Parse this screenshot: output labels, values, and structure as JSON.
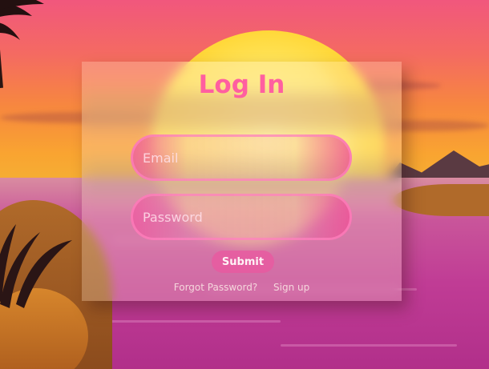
{
  "login": {
    "title": "Log In",
    "email_placeholder": "Email",
    "password_placeholder": "Password",
    "submit_label": "Submit",
    "forgot_password_label": "Forgot Password?",
    "signup_label": "Sign up"
  },
  "colors": {
    "title": "#ff5fa0",
    "accent": "#e85aa0"
  },
  "background": {
    "scene": "sunset-beach"
  }
}
